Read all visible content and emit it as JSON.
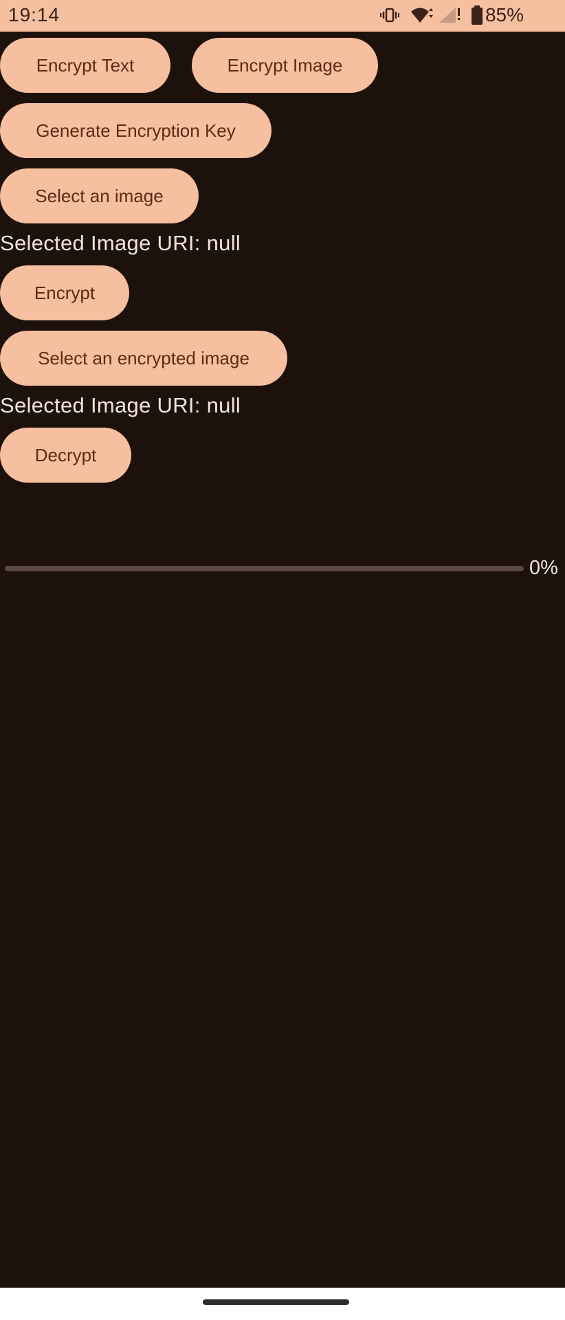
{
  "status_bar": {
    "time": "19:14",
    "battery_percent": "85%",
    "icons": [
      "vibrate-icon",
      "wifi-icon",
      "signal-icon",
      "battery-icon"
    ]
  },
  "buttons": {
    "encrypt_text": "Encrypt Text",
    "encrypt_image": "Encrypt Image",
    "generate_key": "Generate Encryption Key",
    "select_image": "Select an image",
    "encrypt": "Encrypt",
    "select_encrypted_image": "Select an encrypted image",
    "decrypt": "Decrypt"
  },
  "labels": {
    "selected_image_uri_1": "Selected Image URI: null",
    "selected_image_uri_2": "Selected Image URI: null"
  },
  "progress": {
    "value": 0,
    "label": "0%"
  },
  "colors": {
    "background": "#1c110b",
    "accent": "#f5bfa0",
    "button_text": "#5a2c17",
    "text": "#f2e3dc"
  }
}
